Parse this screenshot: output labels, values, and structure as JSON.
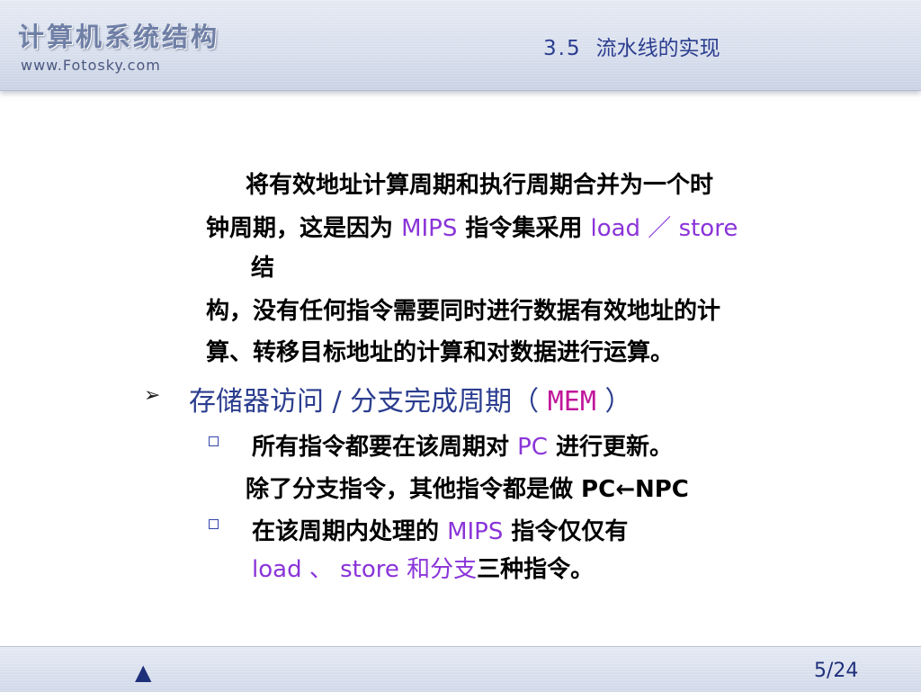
{
  "header": {
    "brand": "计算机系统结构",
    "site": "www.Fotosky.com",
    "section_number": "3.5",
    "section_title": "流水线的实现"
  },
  "body": {
    "p1_line1": "将有效地址计算周期和执行周期合并为一个时",
    "p1_line2_a": "钟周期，这是因为 ",
    "p1_line2_mips": "MIPS",
    "p1_line2_b": " 指令集采用 ",
    "p1_line2_ls": "load ／ store",
    "p1_line3": "结",
    "p1_line4": "构，没有任何指令需要同时进行数据有效地址的计",
    "p1_line5": "算、转移目标地址的计算和对数据进行运算。",
    "heading_text": "存储器访问 / 分支完成周期（ ",
    "heading_code": "MEM",
    "heading_close": " ）",
    "b1_a": "所有指令都要在该周期对 ",
    "b1_pc": "PC",
    "b1_b": " 进行更新。",
    "b1_line2": "除了分支指令，其他指令都是做 PC←NPC",
    "b2_a": "在该周期内处理的 ",
    "b2_mips": "MIPS",
    "b2_b": " 指令仅仅有",
    "b2_line2_purple": "load 、 store 和分支",
    "b2_line2_b": "三种指令。"
  },
  "footer": {
    "up_icon": "▲",
    "page": "5/24"
  }
}
